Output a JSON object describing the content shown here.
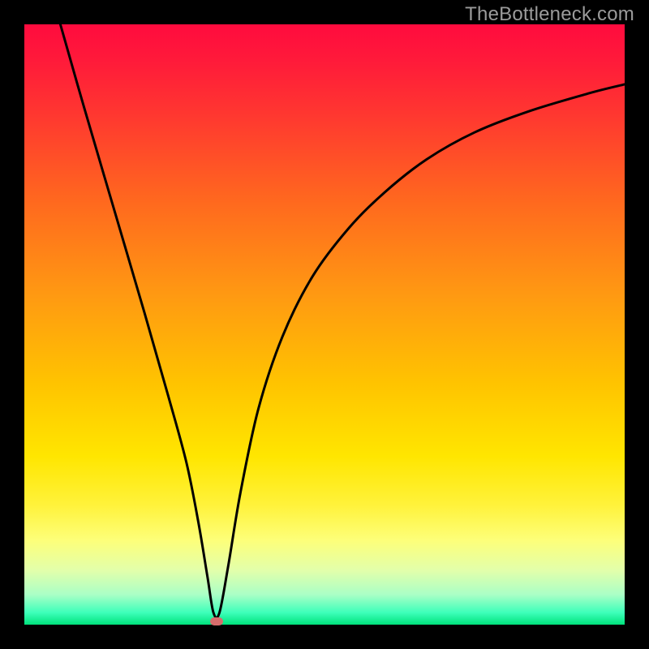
{
  "watermark": "TheBottleneck.com",
  "chart_data": {
    "type": "line",
    "title": "",
    "xlabel": "",
    "ylabel": "",
    "xlim": [
      0,
      100
    ],
    "ylim": [
      0,
      100
    ],
    "series": [
      {
        "name": "curve",
        "x": [
          6,
          10,
          15,
          20,
          24,
          27,
          29,
          30.5,
          31.5,
          32.5,
          34,
          36,
          39,
          43,
          48,
          54,
          60,
          67,
          75,
          84,
          94,
          100
        ],
        "y": [
          100,
          86,
          69,
          52,
          38,
          27,
          17,
          8,
          2,
          2,
          10,
          22,
          36,
          48,
          58,
          66,
          72,
          77.5,
          82,
          85.5,
          88.5,
          90
        ]
      }
    ],
    "marker": {
      "x": 32,
      "y": 0.5
    },
    "background_gradient": [
      "#ff0b3e",
      "#ff9912",
      "#ffe600",
      "#fdff7a",
      "#3dffba",
      "#00e27c"
    ]
  }
}
